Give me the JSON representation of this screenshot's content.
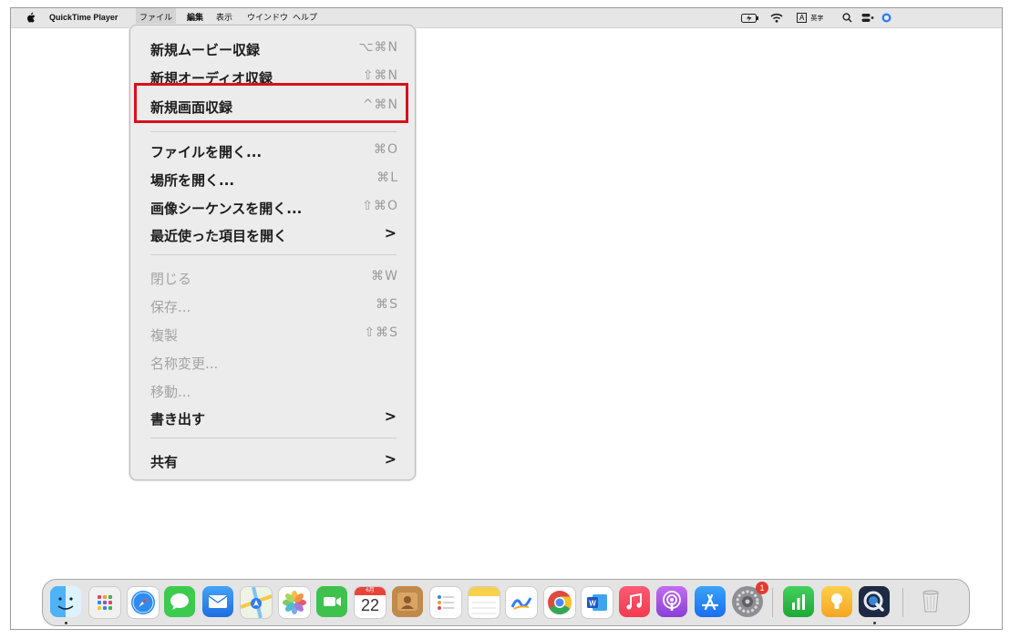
{
  "menubar": {
    "apple": "",
    "app_name": "QuickTime Player",
    "menus": [
      "ファイル",
      "編集",
      "表示",
      "ウインドウ",
      "ヘルプ"
    ],
    "input_badge": "A",
    "input_lang": "英字"
  },
  "file_menu": {
    "new_movie": {
      "label": "新規ムービー収録",
      "shortcut": "⌥⌘N"
    },
    "new_audio": {
      "label": "新規オーディオ収録",
      "shortcut": "⇧⌘N"
    },
    "new_screen": {
      "label": "新規画面収録",
      "shortcut": "^⌘N"
    },
    "open_file": {
      "label": "ファイルを開く...",
      "shortcut": "⌘O"
    },
    "open_location": {
      "label": "場所を開く...",
      "shortcut": "⌘L"
    },
    "open_image_seq": {
      "label": "画像シーケンスを開く...",
      "shortcut": "⇧⌘O"
    },
    "open_recent": {
      "label": "最近使った項目を開く",
      "shortcut": ">"
    },
    "close": {
      "label": "閉じる",
      "shortcut": "⌘W"
    },
    "save": {
      "label": "保存...",
      "shortcut": "⌘S"
    },
    "duplicate": {
      "label": "複製",
      "shortcut": "⇧⌘S"
    },
    "rename": {
      "label": "名称変更..."
    },
    "move": {
      "label": "移動..."
    },
    "export": {
      "label": "書き出す",
      "shortcut": ">"
    },
    "share": {
      "label": "共有",
      "shortcut": ">"
    }
  },
  "dock": {
    "calendar_month": "6月",
    "calendar_day": "22",
    "settings_badge": "1"
  },
  "colors": {
    "highlight_border": "#d8111b"
  }
}
